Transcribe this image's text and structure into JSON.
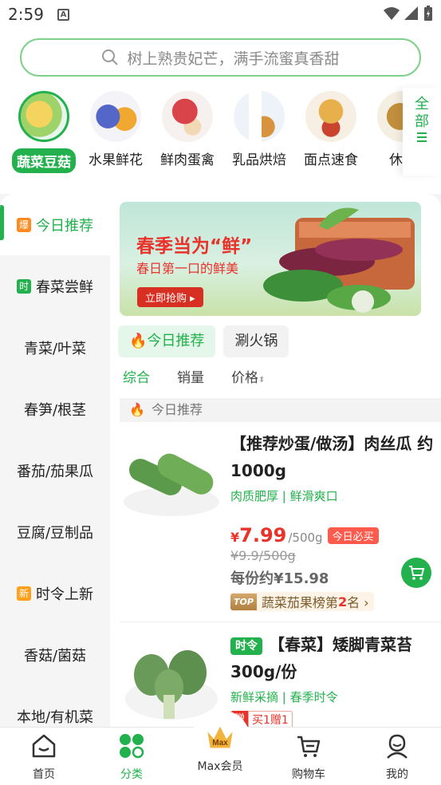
{
  "status": {
    "time": "2:59"
  },
  "search": {
    "placeholder": "树上熟贵妃芒，满手流蜜真香甜"
  },
  "categories": [
    {
      "label": "蔬菜豆菇",
      "active": true
    },
    {
      "label": "水果鲜花"
    },
    {
      "label": "鲜肉蛋禽"
    },
    {
      "label": "乳品烘焙"
    },
    {
      "label": "面点速食"
    },
    {
      "label": "休闲"
    }
  ],
  "all_button": {
    "label1": "全",
    "label2": "部"
  },
  "sidebar": {
    "items": [
      {
        "label": "今日推荐",
        "badge": "爆",
        "badge_color": "#ff8a1f",
        "active": true
      },
      {
        "label": "春菜尝鲜",
        "badge": "时",
        "badge_color": "#22b14c"
      },
      {
        "label": "青菜/叶菜"
      },
      {
        "label": "春笋/根茎"
      },
      {
        "label": "番茄/茄果瓜"
      },
      {
        "label": "豆腐/豆制品"
      },
      {
        "label": "时令上新",
        "badge": "新",
        "badge_color": "#ff9f1a"
      },
      {
        "label": "香菇/菌菇"
      },
      {
        "label": "本地/有机菜"
      }
    ]
  },
  "banner": {
    "title": "春季当为“鲜”",
    "subtitle": "春日第一口的鲜美",
    "button": "立即抢购"
  },
  "tabs": [
    {
      "label": "今日推荐",
      "active": true
    },
    {
      "label": "涮火锅"
    }
  ],
  "sorts": {
    "s1": "综合",
    "s2": "销量",
    "s3": "价格"
  },
  "section": {
    "title": "今日推荐"
  },
  "products": [
    {
      "title": "【推荐炒蛋/做汤】肉丝瓜 约1000g",
      "tagline": "肉质肥厚 | 鲜滑爽口",
      "price_yen": "¥",
      "price": "7.99",
      "unit": "/500g",
      "badge": "今日必买",
      "old_price": "¥9.9/500g",
      "per_serving": "每份约¥15.98",
      "rank_tag": "TOP",
      "rank_text": "蔬菜茄果榜第",
      "rank_num": "2",
      "rank_suffix": "名 ›"
    },
    {
      "chip": "时令",
      "title": "【春菜】矮脚青菜苔300g/份",
      "tagline": "新鲜采摘 | 春季时令",
      "gift1": "赠",
      "gift2": "买1赠1"
    }
  ],
  "bottom_nav": [
    {
      "label": "首页"
    },
    {
      "label": "分类",
      "active": true
    },
    {
      "label": "Max会员",
      "crown_text": "Max"
    },
    {
      "label": "购物车"
    },
    {
      "label": "我的"
    }
  ],
  "colors": {
    "accent": "#22b14c",
    "price": "#e8322a"
  }
}
